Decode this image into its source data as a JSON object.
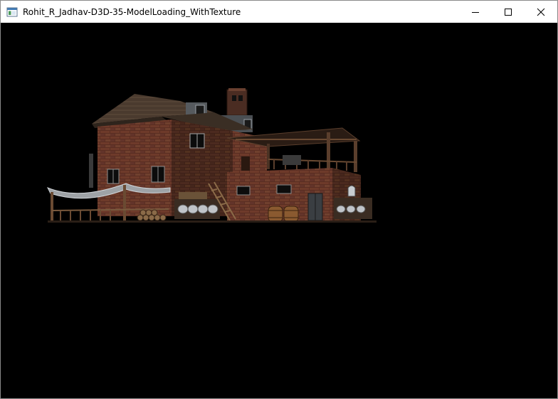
{
  "window": {
    "title": "Rohit_R_Jadhav-D3D-35-ModelLoading_WithTexture",
    "app_icon": "window-app-icon",
    "controls": [
      {
        "name": "minimize",
        "icon": "minimize-icon"
      },
      {
        "name": "maximize",
        "icon": "maximize-icon"
      },
      {
        "name": "close",
        "icon": "close-icon"
      }
    ]
  },
  "viewport": {
    "background_color": "#000000",
    "content": "textured-3d-model-of-brick-warehouse-building"
  }
}
